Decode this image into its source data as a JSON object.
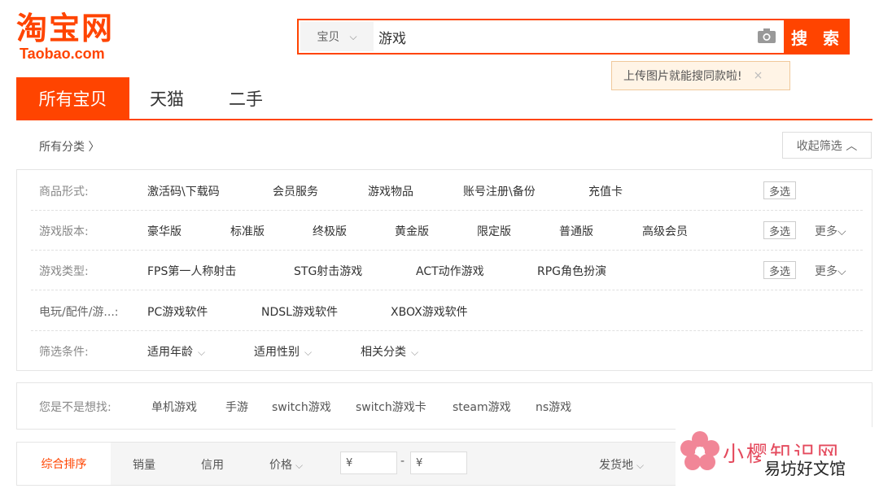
{
  "logo": {
    "cn": "淘宝网",
    "en": "Taobao.com"
  },
  "search": {
    "type_label": "宝贝",
    "query": "游戏",
    "button_label": "搜 索",
    "tooltip": "上传图片就能搜同款啦!",
    "tooltip_close": "×"
  },
  "tabs": [
    {
      "label": "所有宝贝",
      "active": true
    },
    {
      "label": "天猫"
    },
    {
      "label": "二手"
    }
  ],
  "category": {
    "all_label": "所有分类 〉",
    "collapse_label": "收起筛选 ︿"
  },
  "filters": {
    "form": {
      "label": "商品形式:",
      "options": [
        "激活码\\下载码",
        "会员服务",
        "游戏物品",
        "账号注册\\备份",
        "充值卡"
      ],
      "multi": "多选"
    },
    "version": {
      "label": "游戏版本:",
      "options": [
        "豪华版",
        "标准版",
        "终极版",
        "黄金版",
        "限定版",
        "普通版",
        "高级会员"
      ],
      "multi": "多选",
      "more": "更多⌵"
    },
    "type": {
      "label": "游戏类型:",
      "options": [
        "FPS第一人称射击",
        "STG射击游戏",
        "ACT动作游戏",
        "RPG角色扮演"
      ],
      "multi": "多选",
      "more": "更多⌵"
    },
    "console": {
      "label": "电玩/配件/游...:",
      "options": [
        "PC游戏软件",
        "NDSL游戏软件",
        "XBOX游戏软件"
      ]
    },
    "conditions": {
      "label": "筛选条件:",
      "options": [
        "适用年龄",
        "适用性别",
        "相关分类"
      ]
    }
  },
  "suggestions": {
    "label": "您是不是想找:",
    "items": [
      "单机游戏",
      "手游",
      "switch游戏",
      "switch游戏卡",
      "steam游戏",
      "ns游戏"
    ]
  },
  "sort": {
    "active": "综合排序",
    "sales": "销量",
    "credit": "信用",
    "price": "价格",
    "price_from": "¥",
    "price_to": "¥",
    "dash": "-",
    "ship_from": "发货地"
  },
  "watermark": {
    "cn": "小樱知识网",
    "sub": "易坊好文馆"
  },
  "colors": {
    "accent": "#ff4400"
  }
}
